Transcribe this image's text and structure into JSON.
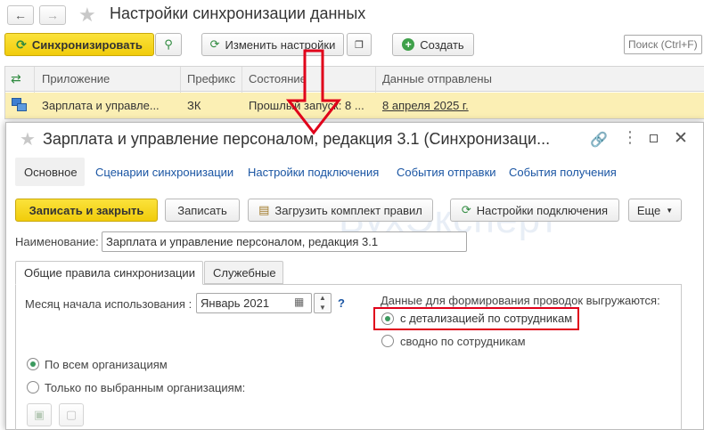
{
  "window": {
    "title": "Настройки синхронизации данных"
  },
  "toolbar": {
    "sync_label": "Синхронизировать",
    "change_settings_label": "Изменить настройки",
    "create_label": "Создать",
    "search_placeholder": "Поиск (Ctrl+F)"
  },
  "table": {
    "columns": [
      "Приложение",
      "Префикс",
      "Состояние",
      "Данные отправлены"
    ],
    "row": {
      "app": "Зарплата и управле...",
      "prefix": "ЗК",
      "state": "Прошлый запуск: 8 ...",
      "sent": "8 апреля 2025 г."
    }
  },
  "dialog": {
    "title": "Зарплата и управление персоналом, редакция 3.1 (Синхронизаци...",
    "tabs": [
      "Основное",
      "Сценарии синхронизации",
      "Настройки подключения",
      "События отправки",
      "События получения"
    ],
    "buttons": {
      "save_close": "Записать и закрыть",
      "save": "Записать",
      "load_rules": "Загрузить комплект правил",
      "connection_settings": "Настройки подключения",
      "more": "Еще"
    },
    "name_label": "Наименование:",
    "name_value": "Зарплата и управление персоналом, редакция 3.1",
    "inner_tabs": [
      "Общие правила синхронизации",
      "Служебные"
    ],
    "month_label": "Месяц начала использования :",
    "month_value": "Январь 2021",
    "help": "?",
    "postings_label": "Данные для формирования проводок выгружаются:",
    "radio_detail": "с детализацией по сотрудникам",
    "radio_summary": "сводно по сотрудникам",
    "radio_all_orgs": "По всем организациям",
    "radio_selected_orgs": "Только по выбранным организациям:"
  },
  "colors": {
    "accent_yellow": "#f5d313",
    "selected_row": "#fbefb4",
    "link_blue": "#1a55a3",
    "highlight_red": "#e0001a",
    "radio_green": "#3c9a5f"
  }
}
